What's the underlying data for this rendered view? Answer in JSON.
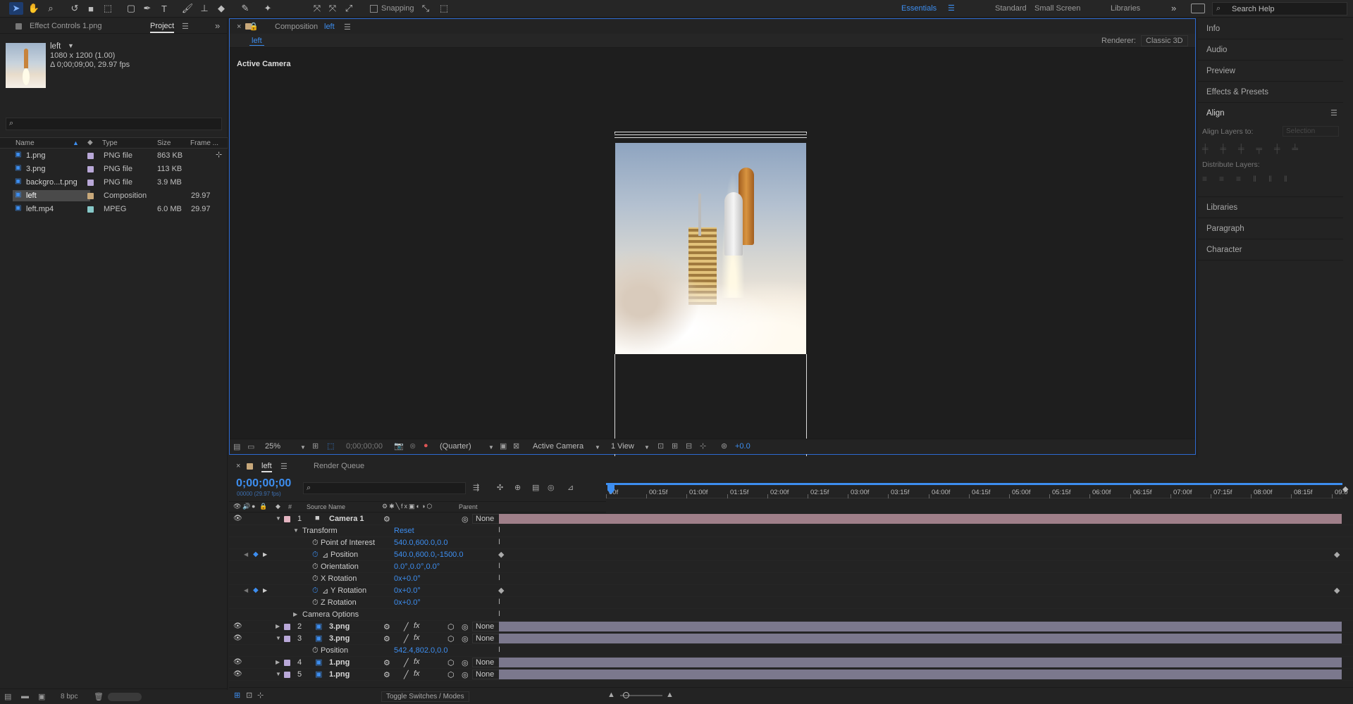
{
  "toolbar": {
    "snapping": "Snapping",
    "workspaces": [
      "Essentials",
      "Standard",
      "Small Screen",
      "Libraries"
    ],
    "search_placeholder": "Search Help"
  },
  "left_panel": {
    "tabs": {
      "effect_controls": "Effect Controls 1.png",
      "project": "Project"
    },
    "item": {
      "name": "left",
      "dims": "1080 x 1200 (1.00)",
      "duration": "Δ 0;00;09;00, 29.97 fps"
    },
    "columns": {
      "name": "Name",
      "type": "Type",
      "size": "Size",
      "frame": "Frame ..."
    },
    "files": [
      {
        "name": "1.png",
        "type": "PNG file",
        "size": "863 KB",
        "frame": "",
        "color": "#b9a8d8",
        "selected": false
      },
      {
        "name": "3.png",
        "type": "PNG file",
        "size": "113 KB",
        "frame": "",
        "color": "#b9a8d8",
        "selected": false
      },
      {
        "name": "backgro...t.png",
        "type": "PNG file",
        "size": "3.9 MB",
        "frame": "",
        "color": "#b9a8d8",
        "selected": false
      },
      {
        "name": "left",
        "type": "Composition",
        "size": "",
        "frame": "29.97",
        "color": "#c8a87a",
        "selected": true
      },
      {
        "name": "left.mp4",
        "type": "MPEG",
        "size": "6.0 MB",
        "frame": "29.97",
        "color": "#86c8c8",
        "selected": false
      }
    ],
    "bpc": "8 bpc"
  },
  "comp_viewer": {
    "tab_label": "Composition",
    "tab_name": "left",
    "subtab": "left",
    "renderer_label": "Renderer:",
    "renderer": "Classic 3D",
    "active_camera": "Active Camera",
    "zoom": "25%",
    "timecode": "0;00;00;00",
    "resolution": "(Quarter)",
    "view": "Active Camera",
    "views": "1 View",
    "exposure": "+0.0"
  },
  "right_panel": {
    "items": [
      "Info",
      "Audio",
      "Preview",
      "Effects & Presets"
    ],
    "align": {
      "title": "Align",
      "align_layers_to": "Align Layers to:",
      "selection": "Selection",
      "distribute": "Distribute Layers:"
    },
    "items2": [
      "Libraries",
      "Paragraph",
      "Character"
    ]
  },
  "timeline": {
    "tab": "left",
    "render_queue": "Render Queue",
    "timecode": "0;00;00;00",
    "fps": "00000 (29.97 fps)",
    "col_headers": {
      "num": "#",
      "source": "Source Name",
      "parent": "Parent"
    },
    "ruler": [
      "00f",
      "00:15f",
      "01:00f",
      "01:15f",
      "02:00f",
      "02:15f",
      "03:00f",
      "03:15f",
      "04:00f",
      "04:15f",
      "05:00f",
      "05:15f",
      "06:00f",
      "06:15f",
      "07:00f",
      "07:15f",
      "08:00f",
      "08:15f",
      "09:0"
    ],
    "rows": [
      {
        "kind": "layer",
        "num": "1",
        "name": "Camera 1",
        "parent": "None",
        "color": "#e3b4c0",
        "expanded": true,
        "bar": "#9f7f89"
      },
      {
        "kind": "group",
        "name": "Transform",
        "value": "Reset"
      },
      {
        "kind": "prop",
        "name": "Point of Interest",
        "value": "540.0,600.0,0.0"
      },
      {
        "kind": "prop",
        "name": "Position",
        "value": "540.0,600.0,-1500.0",
        "keyed": true
      },
      {
        "kind": "prop",
        "name": "Orientation",
        "value": "0.0°,0.0°,0.0°"
      },
      {
        "kind": "prop",
        "name": "X Rotation",
        "value": "0x+0.0°"
      },
      {
        "kind": "prop",
        "name": "Y Rotation",
        "value": "0x+0.0°",
        "keyed": true
      },
      {
        "kind": "prop",
        "name": "Z Rotation",
        "value": "0x+0.0°"
      },
      {
        "kind": "group",
        "name": "Camera Options",
        "value": ""
      },
      {
        "kind": "layer",
        "num": "2",
        "name": "3.png",
        "parent": "None",
        "color": "#b9a8d8",
        "expanded": false,
        "bar": "#7b788d"
      },
      {
        "kind": "layer",
        "num": "3",
        "name": "3.png",
        "parent": "None",
        "color": "#b9a8d8",
        "expanded": true,
        "bar": "#7b788d"
      },
      {
        "kind": "prop",
        "name": "Position",
        "value": "542.4,802.0,0.0"
      },
      {
        "kind": "layer",
        "num": "4",
        "name": "1.png",
        "parent": "None",
        "color": "#b9a8d8",
        "expanded": false,
        "bar": "#7b788d"
      },
      {
        "kind": "layer",
        "num": "5",
        "name": "1.png",
        "parent": "None",
        "color": "#b9a8d8",
        "expanded": true,
        "bar": "#7b788d"
      }
    ],
    "toggle": "Toggle Switches / Modes"
  }
}
